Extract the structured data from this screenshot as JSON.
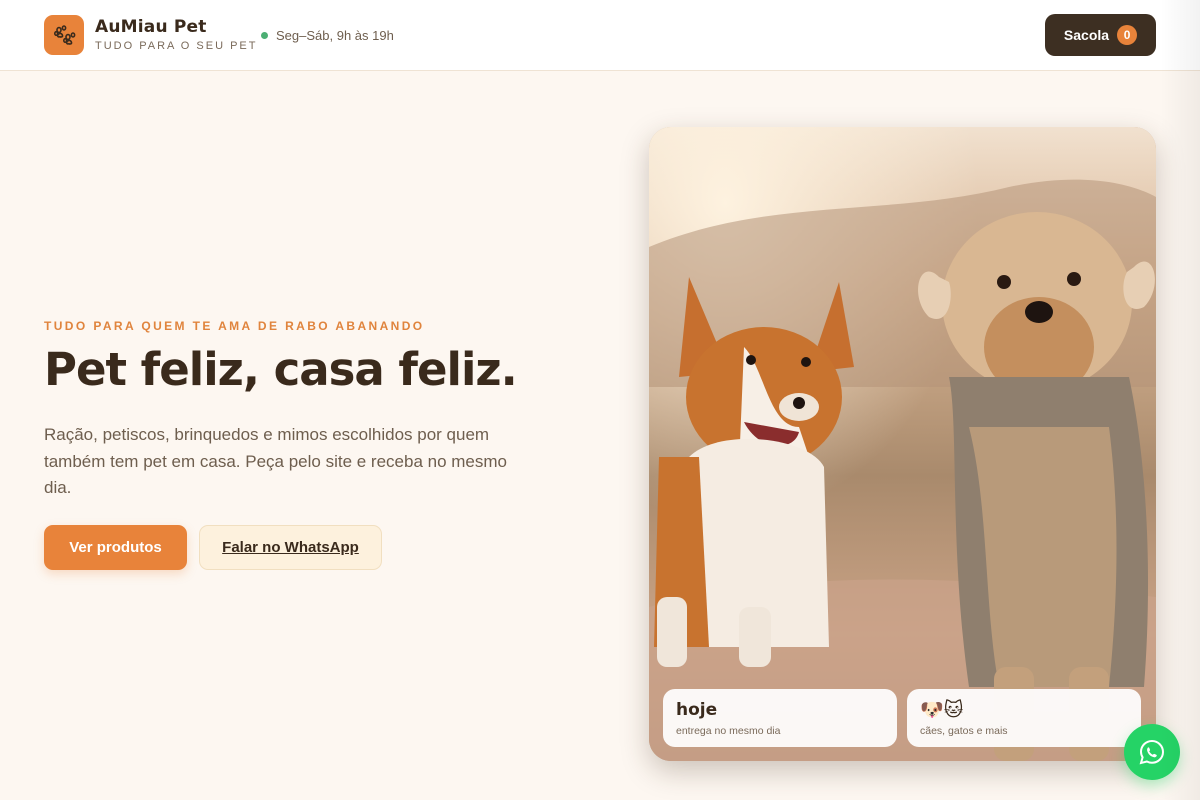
{
  "header": {
    "brand_name": "AuMiau Pet",
    "brand_tagline": "TUDO PARA O SEU PET",
    "hours": "Seg–Sáb, 9h às 19h",
    "bag_label": "Sacola",
    "bag_count": "0",
    "logo_icon": "paw-icon"
  },
  "hero": {
    "eyebrow": "TUDO PARA QUEM TE AMA DE RABO ABANANDO",
    "headline": "Pet feliz, casa feliz.",
    "lead": "Ração, petiscos, brinquedos e mimos escolhidos por quem também tem pet em casa. Peça pelo site e receba no mesmo dia.",
    "primary_button": "Ver produtos",
    "secondary_button": "Falar no WhatsApp"
  },
  "image_cards": [
    {
      "title": "hoje",
      "subtitle": "entrega no mesmo dia"
    },
    {
      "title": "🐶🐱",
      "subtitle": "cães, gatos e mais"
    }
  ],
  "whatsapp_fab_icon": "whatsapp-icon",
  "colors": {
    "accent": "#e8833a",
    "dark": "#3d2f22",
    "background": "#fdf7f1",
    "whatsapp": "#25d366"
  }
}
